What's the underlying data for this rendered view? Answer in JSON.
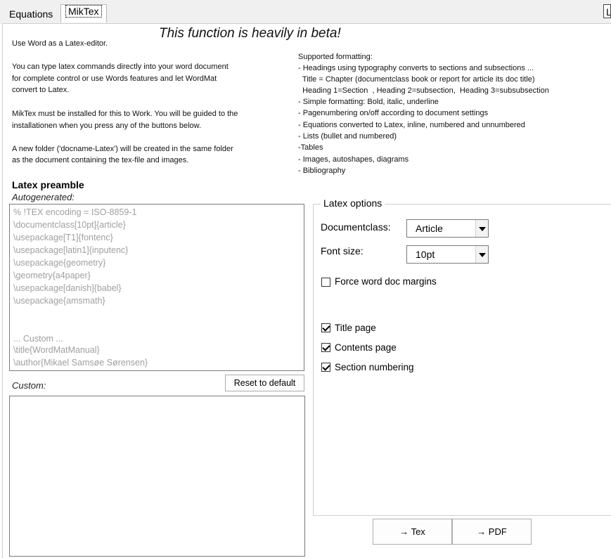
{
  "tabs": [
    {
      "label": "Equations"
    },
    {
      "label": "MikTex"
    }
  ],
  "tab_stub_label": "L",
  "beta_notice": "This function is heavily in beta!",
  "intro": [
    "Use Word as a Latex-editor.",
    "You can type latex commands directly into your word document",
    "for complete control or use Words features and let WordMat",
    "convert to Latex.",
    "MikTex must be installed for this to Work. You will be guided to the",
    "installationen when you press any of the buttons below.",
    "A new folder ('docname-Latex') will be created in the same folder",
    "as the document containing the tex-file and images."
  ],
  "supported": [
    "Supported formatting:",
    "- Headings using typography converts to sections and subsections ...",
    "  Title = Chapter (documentclass book or report for article its doc title)",
    "  Heading 1=Section  , Heading 2=subsection,  Heading 3=subsubsection",
    "- Simple formatting: Bold, italic, underline",
    "- Pagenumbering on/off according to document settings",
    "- Equations converted to Latex, inline, numbered and unnumbered",
    "- Lists (bullet and numbered)",
    "-Tables",
    "- Images, autoshapes, diagrams",
    "- Bibliography"
  ],
  "preamble": {
    "heading": "Latex preamble",
    "autogenerated_label": "Autogenerated:",
    "lines": [
      "% !TEX encoding = ISO-8859-1",
      "\\documentclass[10pt]{article}",
      "\\usepackage[T1]{fontenc}",
      "\\usepackage[latin1]{inputenc}",
      "\\usepackage{geometry}",
      "\\geometry{a4paper}",
      "\\usepackage[danish]{babel}",
      "\\usepackage{amsmath}",
      "",
      "",
      "... Custom ...",
      "\\title{WordMatManual}",
      "\\author{Mikael Samsøe Sørensen}"
    ],
    "custom_label": "Custom:",
    "reset_button": "Reset to default",
    "custom_value": ""
  },
  "options": {
    "legend": "Latex options",
    "documentclass_label": "Documentclass:",
    "documentclass_value": "Article",
    "fontsize_label": "Font size:",
    "fontsize_value": "10pt",
    "force_margins": {
      "label": "Force word doc margins",
      "checked": false
    },
    "title_page": {
      "label": "Title page",
      "checked": true
    },
    "contents_page": {
      "label": "Contents page",
      "checked": true
    },
    "section_numbering": {
      "label": "Section numbering",
      "checked": true
    }
  },
  "actions": {
    "tex_button": "→ Tex",
    "pdf_button": "→ PDF"
  }
}
